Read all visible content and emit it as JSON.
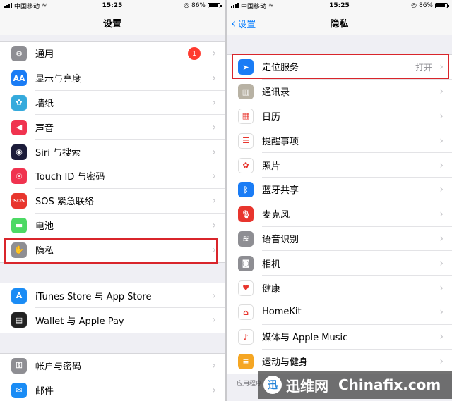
{
  "status": {
    "carrier": "中国移动",
    "time": "15:25",
    "battery": "86%",
    "battery_level": 0.86
  },
  "left": {
    "title": "设置",
    "section1": [
      {
        "label": "通用",
        "icon": "gear-icon",
        "color": "#8e8e93",
        "glyph": "⚙",
        "badge": "1"
      },
      {
        "label": "显示与亮度",
        "icon": "display-icon",
        "color": "#1a7cf5",
        "glyph": "AA"
      },
      {
        "label": "墙纸",
        "icon": "wallpaper-icon",
        "color": "#35aadc",
        "glyph": "✿"
      },
      {
        "label": "声音",
        "icon": "speaker-icon",
        "color": "#f0334f",
        "glyph": "◀"
      },
      {
        "label": "Siri 与搜索",
        "icon": "siri-icon",
        "color": "#1c1c3a",
        "glyph": "◉"
      },
      {
        "label": "Touch ID 与密码",
        "icon": "fingerprint-icon",
        "color": "#f0334f",
        "glyph": "☉"
      },
      {
        "label": "SOS 紧急联络",
        "icon": "sos-icon",
        "color": "#e8352d",
        "glyph": "SOS"
      },
      {
        "label": "电池",
        "icon": "battery-icon",
        "color": "#4cd964",
        "glyph": "▬"
      },
      {
        "label": "隐私",
        "icon": "hand-icon",
        "color": "#8e8e93",
        "glyph": "✋"
      }
    ],
    "section2": [
      {
        "label": "iTunes Store 与 App Store",
        "icon": "app-store-icon",
        "color": "#1a8cf5",
        "glyph": "A"
      },
      {
        "label": "Wallet 与 Apple Pay",
        "icon": "wallet-icon",
        "color": "#222222",
        "glyph": "▤"
      }
    ],
    "section3": [
      {
        "label": "帐户与密码",
        "icon": "key-icon",
        "color": "#8e8e93",
        "glyph": "⚿"
      },
      {
        "label": "邮件",
        "icon": "mail-icon",
        "color": "#1a8cf5",
        "glyph": "✉"
      }
    ]
  },
  "right": {
    "back": "设置",
    "title": "隐私",
    "items": [
      {
        "label": "定位服务",
        "icon": "location-icon",
        "color": "#1a7cf5",
        "glyph": "➤",
        "detail": "打开"
      },
      {
        "label": "通讯录",
        "icon": "contacts-icon",
        "color": "#b8b2a4",
        "glyph": "▥"
      },
      {
        "label": "日历",
        "icon": "calendar-icon",
        "color": "#ffffff",
        "glyph": "▦"
      },
      {
        "label": "提醒事项",
        "icon": "reminders-icon",
        "color": "#ffffff",
        "glyph": "☰"
      },
      {
        "label": "照片",
        "icon": "photos-icon",
        "color": "#ffffff",
        "glyph": "✿"
      },
      {
        "label": "蓝牙共享",
        "icon": "bluetooth-icon",
        "color": "#1a7cf5",
        "glyph": "ᛒ"
      },
      {
        "label": "麦克风",
        "icon": "microphone-icon",
        "color": "#e8352d",
        "glyph": "🎙"
      },
      {
        "label": "语音识别",
        "icon": "waveform-icon",
        "color": "#8e8e93",
        "glyph": "≋"
      },
      {
        "label": "相机",
        "icon": "camera-icon",
        "color": "#8e8e93",
        "glyph": "◙"
      },
      {
        "label": "健康",
        "icon": "health-icon",
        "color": "#ffffff",
        "glyph": "♥"
      },
      {
        "label": "HomeKit",
        "icon": "home-icon",
        "color": "#ffffff",
        "glyph": "⌂"
      },
      {
        "label": "媒体与 Apple Music",
        "icon": "music-icon",
        "color": "#ffffff",
        "glyph": "♪"
      },
      {
        "label": "运动与健身",
        "icon": "fitness-icon",
        "color": "#f5a623",
        "glyph": "≡"
      }
    ],
    "footnote": "应用程序"
  },
  "watermark": {
    "logo": "迅",
    "cn": "迅维网",
    "en": "Chinafix.com"
  }
}
